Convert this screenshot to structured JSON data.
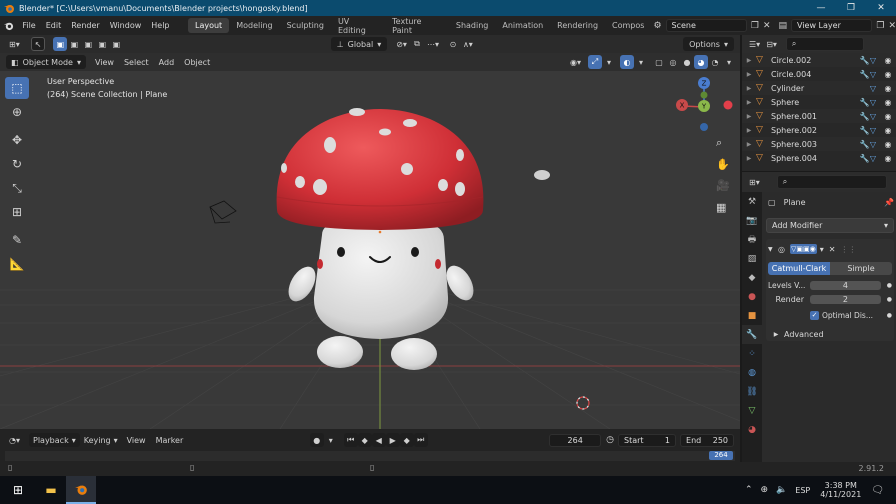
{
  "window": {
    "title": "Blender* [C:\\Users\\vmanu\\Documents\\Blender projects\\hongosky.blend]",
    "controls": [
      "—",
      "❐",
      "✕"
    ]
  },
  "menubar": {
    "menus": [
      "File",
      "Edit",
      "Render",
      "Window",
      "Help"
    ],
    "workspaces": [
      "Layout",
      "Modeling",
      "Sculpting",
      "UV Editing",
      "Texture Paint",
      "Shading",
      "Animation",
      "Rendering",
      "Compos"
    ],
    "active_workspace": "Layout",
    "scene": "Scene",
    "view_layer": "View Layer"
  },
  "viewport": {
    "header": {
      "transform_orientation": "Global",
      "options_label": "Options"
    },
    "header2": {
      "mode": "Object Mode",
      "menus": [
        "View",
        "Select",
        "Add",
        "Object"
      ]
    },
    "info_line1": "User Perspective",
    "info_line2": "(264) Scene Collection | Plane",
    "gizmo": {
      "x": "X",
      "y": "Y",
      "z": "Z"
    }
  },
  "timeline": {
    "menus": [
      "Playback",
      "Keying",
      "View",
      "Marker"
    ],
    "current_frame": "264",
    "start_label": "Start",
    "start_value": "1",
    "end_label": "End",
    "end_value": "250",
    "ruler_current": "264"
  },
  "outliner": {
    "items": [
      {
        "name": "Circle.002"
      },
      {
        "name": "Circle.004"
      },
      {
        "name": "Cylinder"
      },
      {
        "name": "Sphere"
      },
      {
        "name": "Sphere.001"
      },
      {
        "name": "Sphere.002"
      },
      {
        "name": "Sphere.003"
      },
      {
        "name": "Sphere.004"
      }
    ]
  },
  "properties": {
    "object_name": "Plane",
    "add_modifier_label": "Add Modifier",
    "subdiv_tabs": [
      "Catmull-Clark",
      "Simple"
    ],
    "levels_label": "Levels V...",
    "levels_value": "4",
    "render_label": "Render",
    "render_value": "2",
    "optimal_label": "Optimal Dis...",
    "advanced_label": "Advanced"
  },
  "statusbar": {
    "version": "2.91.2"
  },
  "taskbar": {
    "lang": "ESP",
    "time": "3:38 PM",
    "date": "4/11/2021"
  },
  "colors": {
    "accent_blue": "#4772b3",
    "cap_red": "#d3343a",
    "titlebar": "#0b4b6e",
    "mesh_orange": "#e59340"
  }
}
